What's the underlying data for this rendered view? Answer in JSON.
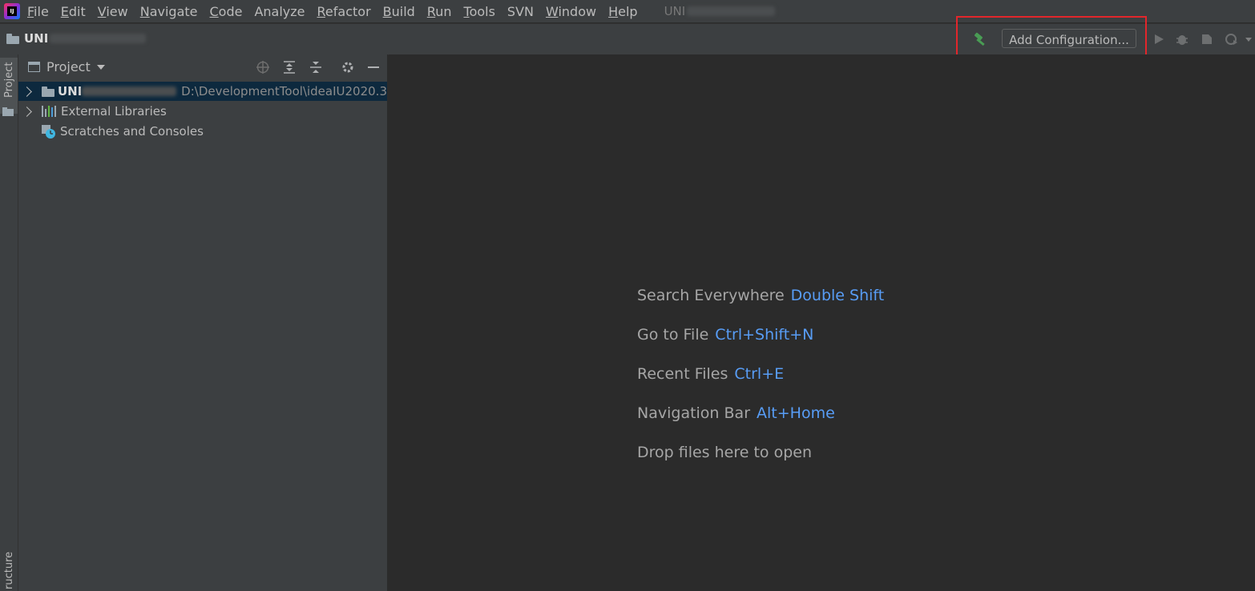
{
  "menubar": {
    "items": [
      {
        "mnemonic": "F",
        "rest": "ile"
      },
      {
        "mnemonic": "E",
        "rest": "dit"
      },
      {
        "mnemonic": "V",
        "rest": "iew"
      },
      {
        "mnemonic": "N",
        "rest": "avigate"
      },
      {
        "mnemonic": "C",
        "rest": "ode"
      },
      {
        "mnemonic": "",
        "rest": "Analyze"
      },
      {
        "mnemonic": "R",
        "rest": "efactor"
      },
      {
        "mnemonic": "B",
        "rest": "uild"
      },
      {
        "mnemonic": "R",
        "rest": "un"
      },
      {
        "mnemonic": "T",
        "rest": "ools"
      },
      {
        "mnemonic": "",
        "rest": "SVN"
      },
      {
        "mnemonic": "W",
        "rest": "indow"
      },
      {
        "mnemonic": "H",
        "rest": "elp"
      }
    ],
    "window_title": "UNI"
  },
  "navbar": {
    "project_crumb": "UNI",
    "add_configuration_label": "Add Configuration..."
  },
  "left_strip": {
    "project_tab": "Project",
    "structure_tab": "ructure"
  },
  "project_panel": {
    "title": "Project",
    "tree": [
      {
        "label": "UNI",
        "path": "D:\\DevelopmentTool\\ideaIU2020.3"
      },
      {
        "label": "External Libraries"
      },
      {
        "label": "Scratches and Consoles"
      }
    ]
  },
  "editor": {
    "hints": [
      {
        "label": "Search Everywhere",
        "key": "Double Shift"
      },
      {
        "label": "Go to File",
        "key": "Ctrl+Shift+N"
      },
      {
        "label": "Recent Files",
        "key": "Ctrl+E"
      },
      {
        "label": "Navigation Bar",
        "key": "Alt+Home"
      },
      {
        "label": "Drop files here to open",
        "key": ""
      }
    ]
  },
  "colors": {
    "background": "#2b2b2b",
    "panel": "#3c3f41",
    "selection": "#0d293e",
    "link_key": "#589df6",
    "highlight_border": "#e2262b",
    "build_green": "#499c54"
  },
  "icons": [
    "app-logo-icon",
    "folder-icon",
    "hammer-icon",
    "run-icon",
    "debug-icon",
    "coverage-icon",
    "profile-icon",
    "locate-icon",
    "expand-all-icon",
    "collapse-all-icon",
    "gear-icon",
    "minimize-icon",
    "library-icon",
    "scratch-icon"
  ]
}
